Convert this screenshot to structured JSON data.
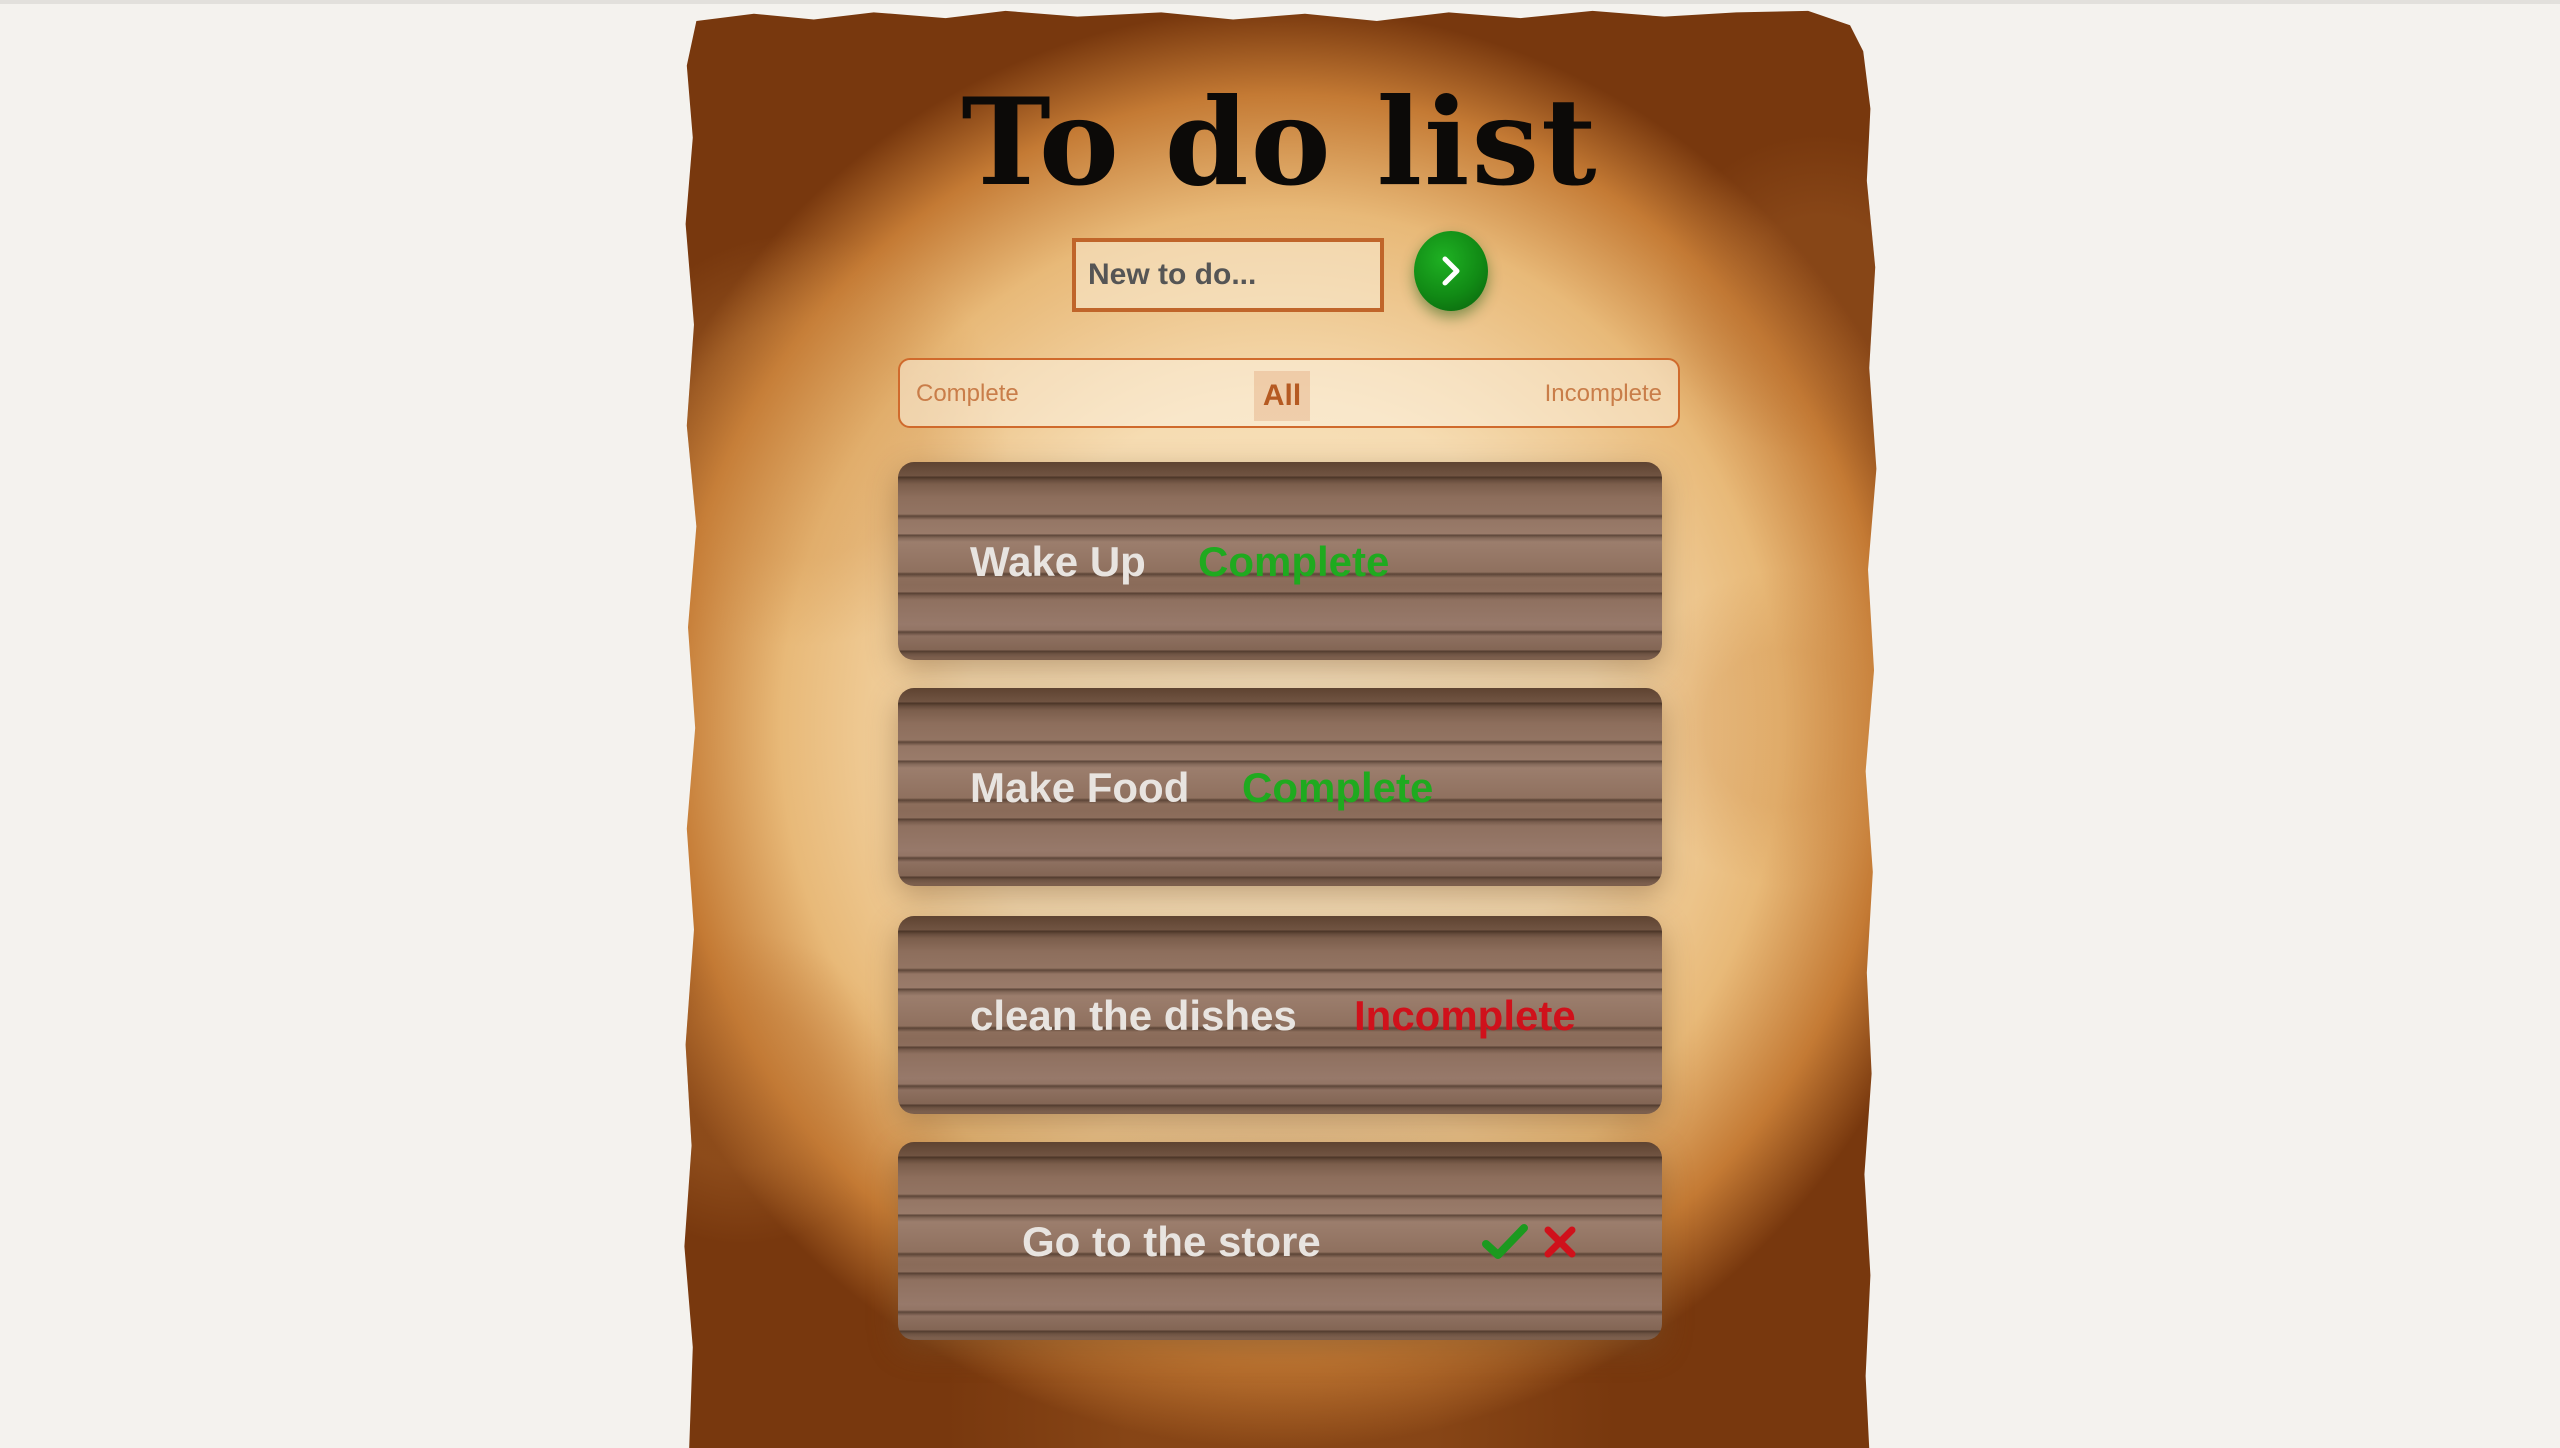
{
  "app": {
    "title": "To do list"
  },
  "new_todo": {
    "placeholder": "New to do...",
    "submit_icon": "chevron-right-icon"
  },
  "filters": {
    "complete_label": "Complete",
    "all_label": "All",
    "incomplete_label": "Incomplete",
    "selected": "All"
  },
  "todos": [
    {
      "text": "Wake Up",
      "status": "Complete"
    },
    {
      "text": "Make Food",
      "status": "Complete"
    },
    {
      "text": "clean the dishes",
      "status": "Incomplete"
    },
    {
      "text": "Go to the store",
      "status": "",
      "actions": [
        "check-icon",
        "x-icon"
      ]
    }
  ],
  "colors": {
    "complete": "#1faa1f",
    "incomplete": "#d0111b",
    "accent": "#c0652a",
    "button": "#118a15"
  }
}
